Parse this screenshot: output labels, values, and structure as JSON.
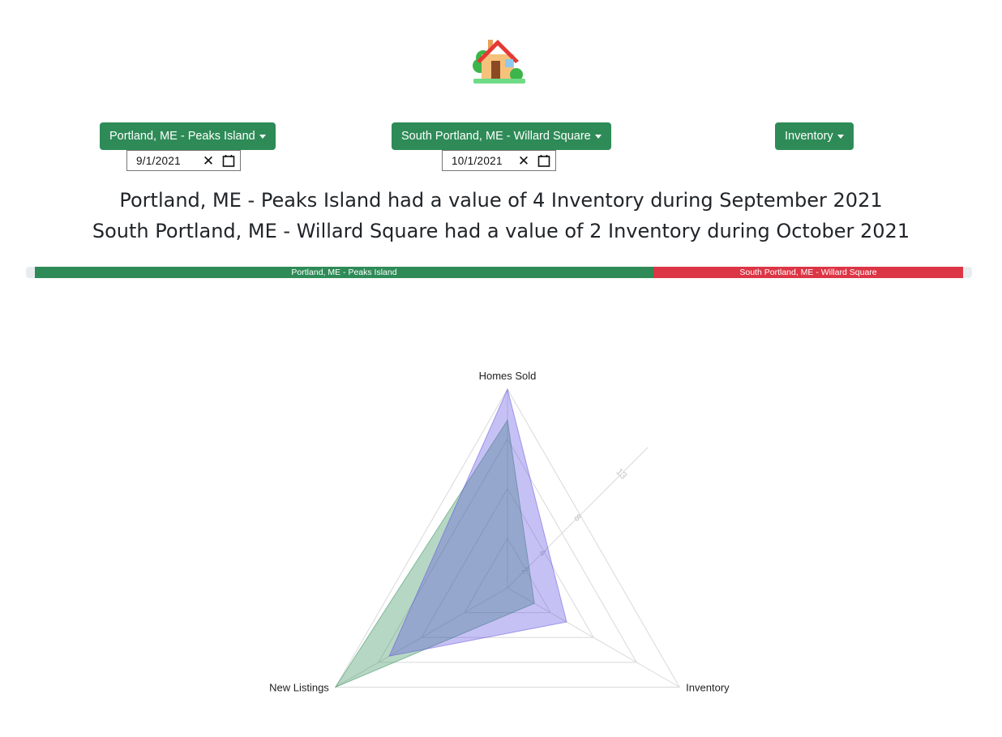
{
  "logo": {
    "icon": "house-emoji-icon"
  },
  "selectors": {
    "location_a": "Portland, ME - Peaks Island",
    "location_b": "South Portland, ME - Willard Square",
    "metric": "Inventory"
  },
  "dates": {
    "date_a": "9/1/2021",
    "date_b": "10/1/2021"
  },
  "headlines": {
    "line_1": "Portland, ME - Peaks Island had a value of 4 Inventory during September 2021",
    "line_2": "South Portland, ME - Willard Square had a value of 2 Inventory during October 2021"
  },
  "comparison_bar": {
    "segment_a": {
      "label": "Portland, ME - Peaks Island",
      "color": "#2e8b57",
      "share": 0.667
    },
    "segment_b": {
      "label": "South Portland, ME - Willard Square",
      "color": "#dc3545",
      "share": 0.333
    }
  },
  "chart_data": {
    "type": "radar",
    "axes": [
      "Homes Sold",
      "Inventory",
      "New Listings"
    ],
    "ticks": [
      "2",
      "4",
      "8",
      "13"
    ],
    "series": [
      {
        "color": "#2e8b57",
        "values": [
          13.5,
          2.5,
          16
        ]
      },
      {
        "color": "#5c4de0",
        "values": [
          16,
          5.5,
          11
        ]
      }
    ]
  }
}
